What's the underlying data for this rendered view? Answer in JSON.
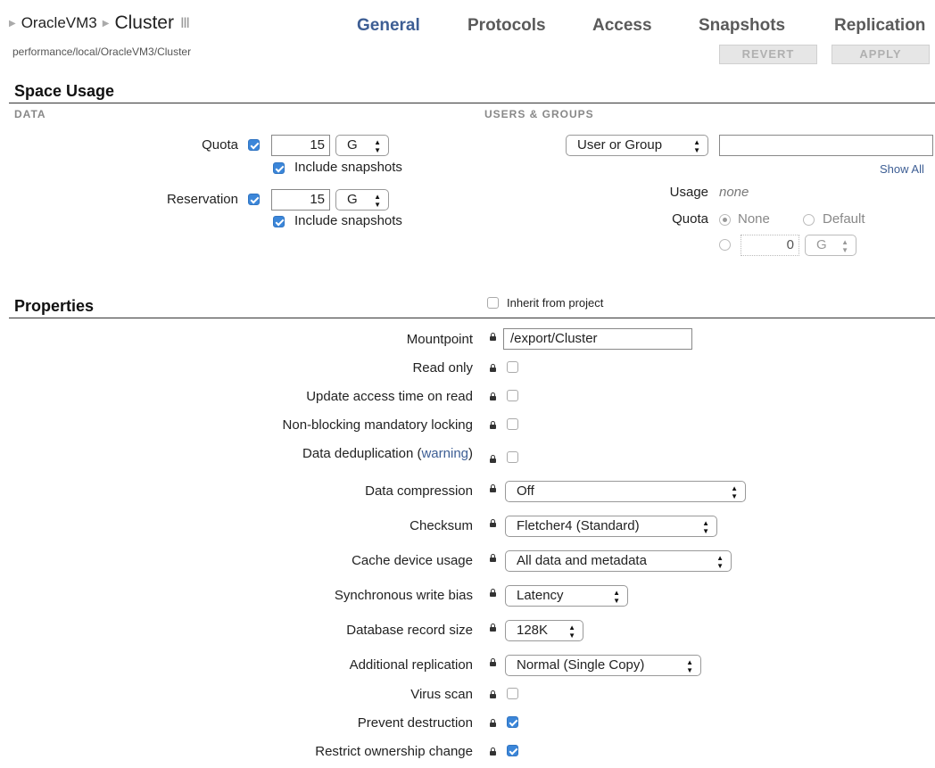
{
  "breadcrumb": {
    "parent": "OracleVM3",
    "current": "Cluster"
  },
  "tabs": [
    "General",
    "Protocols",
    "Access",
    "Snapshots",
    "Replication"
  ],
  "path": "performance/local/OracleVM3/Cluster",
  "buttons": {
    "revert": "REVERT",
    "apply": "APPLY"
  },
  "space_usage": {
    "title": "Space Usage",
    "data_label": "DATA",
    "users_groups_label": "USERS & GROUPS",
    "quota": {
      "label": "Quota",
      "value": "15",
      "unit": "G",
      "include_snapshots": "Include snapshots"
    },
    "reservation": {
      "label": "Reservation",
      "value": "15",
      "unit": "G",
      "include_snapshots": "Include snapshots"
    },
    "user_group_select": "User or Group",
    "show_all": "Show All",
    "usage_label": "Usage",
    "usage_value": "none",
    "ug_quota_label": "Quota",
    "ug_quota_none": "None",
    "ug_quota_default": "Default",
    "ug_quota_value": "0",
    "ug_quota_unit": "G"
  },
  "properties": {
    "title": "Properties",
    "inherit": "Inherit from project",
    "mountpoint_label": "Mountpoint",
    "mountpoint_value": "/export/Cluster",
    "read_only": "Read only",
    "update_atime": "Update access time on read",
    "nbmand": "Non-blocking mandatory locking",
    "dedup_prefix": "Data deduplication (",
    "dedup_link": "warning",
    "dedup_suffix": ")",
    "compression_label": "Data compression",
    "compression_value": "Off",
    "checksum_label": "Checksum",
    "checksum_value": "Fletcher4 (Standard)",
    "cache_label": "Cache device usage",
    "cache_value": "All data and metadata",
    "syncbias_label": "Synchronous write bias",
    "syncbias_value": "Latency",
    "recordsize_label": "Database record size",
    "recordsize_value": "128K",
    "copies_label": "Additional replication",
    "copies_value": "Normal (Single Copy)",
    "virus_scan": "Virus scan",
    "prevent_destruction": "Prevent destruction",
    "restrict_chown": "Restrict ownership change"
  },
  "colors": {
    "active_tab": "#3d5e94",
    "checkbox": "#3b86d9",
    "link": "#3d5e94"
  }
}
